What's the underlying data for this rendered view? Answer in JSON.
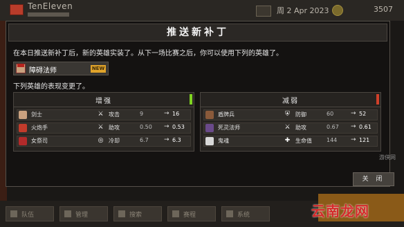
{
  "background": {
    "team_name": "TenEleven",
    "date": "周 2 Apr 2023",
    "money": "3507",
    "bottom_buttons": [
      "队伍",
      "管理",
      "搜索",
      "赛程",
      "系统"
    ]
  },
  "modal": {
    "title": "推送新补丁",
    "intro": "在本日推送新补丁后，新的英雄实装了。从下一场比赛之后，你可以使用下列的英雄了。",
    "new_hero": {
      "name": "障碍法师",
      "badge": "NEW"
    },
    "changed_text": "下列英雄的表现变更了。",
    "buff_panel": {
      "title": "增强",
      "flag_color": "#7ed321",
      "rows": [
        {
          "hero": "剑士",
          "stat_icon": "sword-icon",
          "stat": "攻击",
          "old": "9",
          "arrow": "→",
          "new": "16",
          "avatar_color": "#c9a17f"
        },
        {
          "hero": "火炮手",
          "stat_icon": "sword-icon",
          "stat": "助攻",
          "old": "0.50",
          "arrow": "→",
          "new": "0.53",
          "avatar_color": "#c23b2b"
        },
        {
          "hero": "女祭司",
          "stat_icon": "cooldown-icon",
          "stat": "冷却",
          "old": "6.7",
          "arrow": "→",
          "new": "6.3",
          "avatar_color": "#b22a2a"
        }
      ]
    },
    "nerf_panel": {
      "title": "减弱",
      "flag_color": "#d0402a",
      "rows": [
        {
          "hero": "盾牌兵",
          "stat_icon": "shield-icon",
          "stat": "防御",
          "old": "60",
          "arrow": "→",
          "new": "52",
          "avatar_color": "#8a5a3a"
        },
        {
          "hero": "死灵法师",
          "stat_icon": "sword-icon",
          "stat": "助攻",
          "old": "0.67",
          "arrow": "→",
          "new": "0.61",
          "avatar_color": "#6a4a8a"
        },
        {
          "hero": "鬼魂",
          "stat_icon": "cross-icon",
          "stat": "生命值",
          "old": "144",
          "arrow": "→",
          "new": "121",
          "avatar_color": "#d8d8d8"
        }
      ]
    },
    "close_label": "关 闭"
  },
  "watermark": {
    "site": "云南龙网",
    "small": "游侠网"
  }
}
